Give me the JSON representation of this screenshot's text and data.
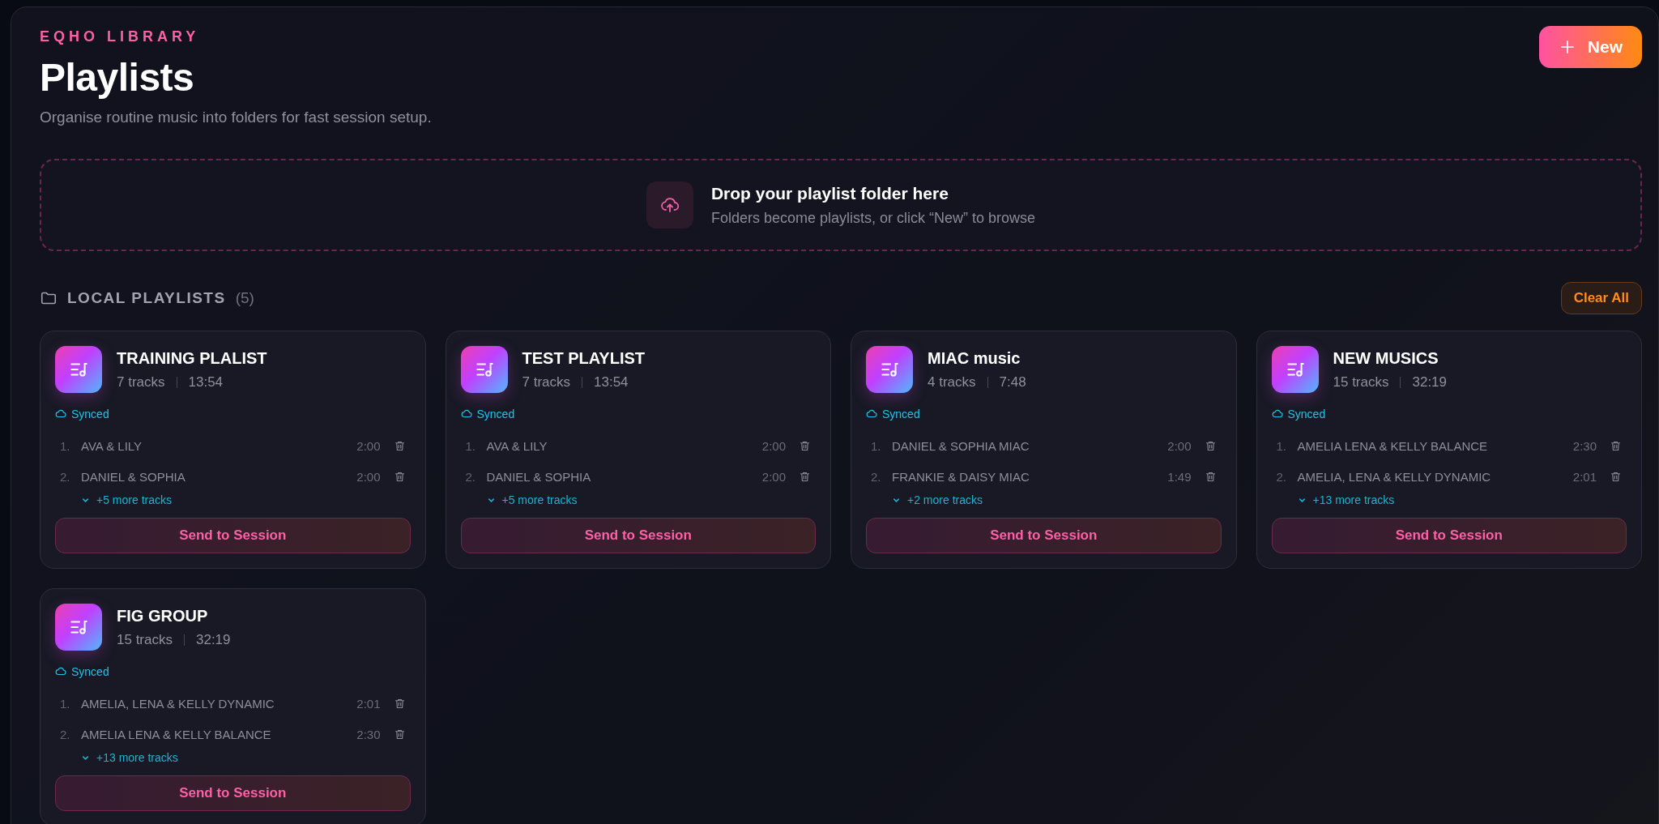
{
  "header": {
    "eyebrow": "EQHO LIBRARY",
    "title": "Playlists",
    "subtitle": "Organise routine music into folders for fast session setup.",
    "new_button": "New"
  },
  "dropzone": {
    "title": "Drop your playlist folder here",
    "hint": "Folders become playlists, or click “New” to browse"
  },
  "section": {
    "title": "LOCAL PLAYLISTS",
    "count": "(5)",
    "clear_button": "Clear All"
  },
  "playlists": [
    {
      "name": "TRAINING PLALIST",
      "tracks": "7 tracks",
      "duration": "13:54",
      "status": "Synced",
      "items": [
        {
          "number": "1.",
          "title": "AVA & LILY",
          "duration": "2:00"
        },
        {
          "number": "2.",
          "title": "DANIEL & SOPHIA",
          "duration": "2:00"
        }
      ],
      "more": "+5 more tracks",
      "expanded": false,
      "action": "Send to Session"
    },
    {
      "name": "TEST PLAYLIST",
      "tracks": "7 tracks",
      "duration": "13:54",
      "status": "Synced",
      "items": [
        {
          "number": "1.",
          "title": "AVA & LILY",
          "duration": "2:00"
        },
        {
          "number": "2.",
          "title": "DANIEL & SOPHIA",
          "duration": "2:00"
        }
      ],
      "more": "+5 more tracks",
      "expanded": false,
      "action": "Send to Session"
    },
    {
      "name": "MIAC music",
      "tracks": "4 tracks",
      "duration": "7:48",
      "status": "Synced",
      "items": [
        {
          "number": "1.",
          "title": "DANIEL & SOPHIA MIAC",
          "duration": "2:00"
        },
        {
          "number": "2.",
          "title": "FRANKIE & DAISY MIAC",
          "duration": "1:49"
        }
      ],
      "more": "+2 more tracks",
      "expanded": false,
      "action": "Send to Session"
    },
    {
      "name": "NEW MUSICS",
      "tracks": "15 tracks",
      "duration": "32:19",
      "status": "Synced",
      "items": [
        {
          "number": "1.",
          "title": "AMELIA LENA & KELLY BALANCE",
          "duration": "2:30"
        },
        {
          "number": "2.",
          "title": "AMELIA, LENA & KELLY DYNAMIC",
          "duration": "2:01"
        }
      ],
      "more": "+13 more tracks",
      "expanded": false,
      "action": "Send to Session"
    },
    {
      "name": "FIG GROUP",
      "tracks": "15 tracks",
      "duration": "32:19",
      "status": "Synced",
      "items": [
        {
          "number": "1.",
          "title": "AMELIA, LENA & KELLY DYNAMIC",
          "duration": "2:01"
        },
        {
          "number": "2.",
          "title": "AMELIA LENA & KELLY BALANCE",
          "duration": "2:30"
        }
      ],
      "more": "+13 more tracks",
      "expanded": false,
      "action": "Send to Session"
    }
  ]
}
